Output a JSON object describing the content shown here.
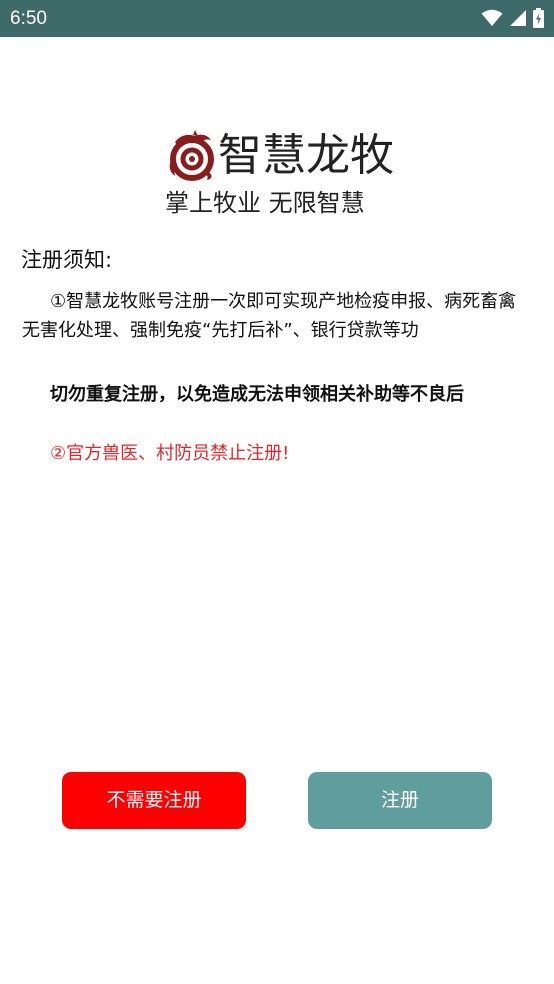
{
  "status_bar": {
    "time": "6:50",
    "icons": [
      "wifi-icon",
      "signal-icon",
      "battery-icon"
    ]
  },
  "logo": {
    "name": "智慧龙牧",
    "slogan": "掌上牧业  无限智慧",
    "emblem_icon": "dragon-emblem-icon",
    "emblem_color": "#8b1c1c"
  },
  "notice": {
    "title": "注册须知:",
    "item_1": "①智慧龙牧账号注册一次即可实现产地检疫申报、病死畜禽无害化处理、强制免疫“先打后补”、银行贷款等功",
    "warning": "切勿重复注册，以免造成无法申领相关补助等不良后",
    "item_2": "②官方兽医、村防员禁止注册!",
    "warning_color": "#e5252a"
  },
  "buttons": {
    "skip_label": "不需要注册",
    "register_label": "注册",
    "skip_color": "#ff0000",
    "register_color": "#5f9e9c"
  }
}
